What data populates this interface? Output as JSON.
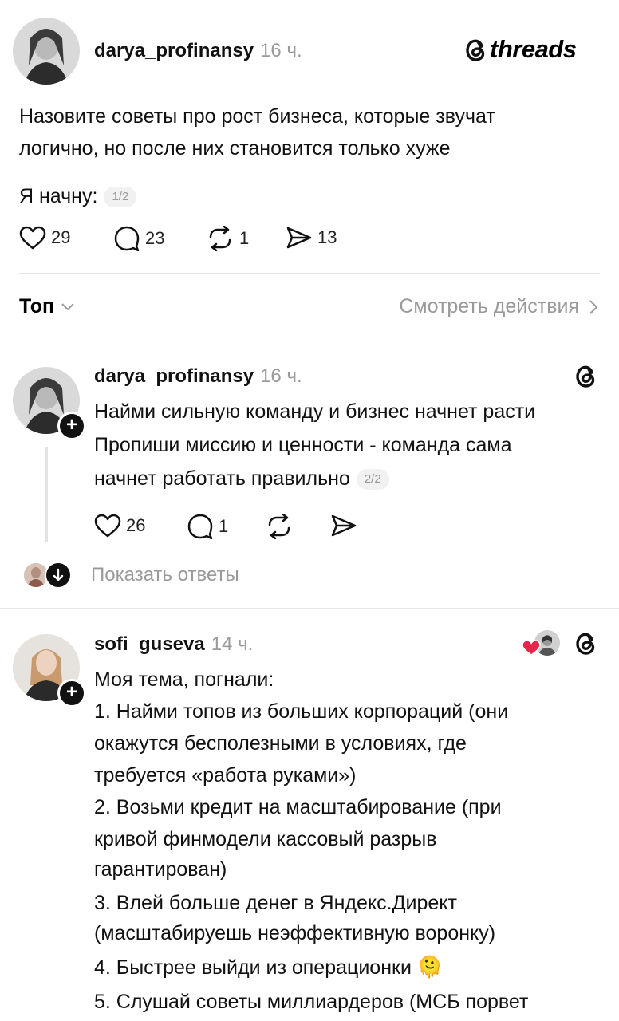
{
  "brand": {
    "wordmark": "threads"
  },
  "post": {
    "username": "darya_profinansy",
    "time": "16 ч.",
    "lines": [
      "Назовите советы про рост бизнеса, которые звучат",
      "логично, но после них становится только хуже"
    ],
    "intro": "Я начну:",
    "counter": "1/2",
    "likes": "29",
    "comments": "23",
    "reposts": "1",
    "shares": "13"
  },
  "sort": {
    "label": "Топ",
    "activity_link": "Смотреть действия"
  },
  "reply1": {
    "username": "darya_profinansy",
    "time": "16 ч.",
    "lines": [
      "Найми сильную команду и бизнес начнет расти",
      "Пропиши миссию и ценности - команда сама",
      "начнет работать правильно"
    ],
    "counter": "2/2",
    "likes": "26",
    "comments": "1",
    "show_replies": "Показать ответы"
  },
  "reply2": {
    "username": "sofi_guseva",
    "time": "14 ч.",
    "lines": [
      "Моя тема, погнали:",
      "1. Найми топов из больших корпораций (они",
      "окажутся бесполезными в условиях, где",
      "требуется «работа руками»)",
      "2. Возьми кредит на масштабирование (при",
      "кривой финмодели кассовый разрыв",
      "гарантирован)",
      "3. Влей больше денег в Яндекс.Директ",
      "(масштабируешь неэффективную воронку)",
      "4. Быстрее выйди из операционки",
      "5. Слушай советы миллиардеров (МСБ порвет"
    ],
    "emoji": "🫠"
  },
  "colors": {
    "text": "#111111",
    "muted": "#9a9a9a",
    "divider": "#e6e6e6",
    "heart": "#e8264b"
  }
}
